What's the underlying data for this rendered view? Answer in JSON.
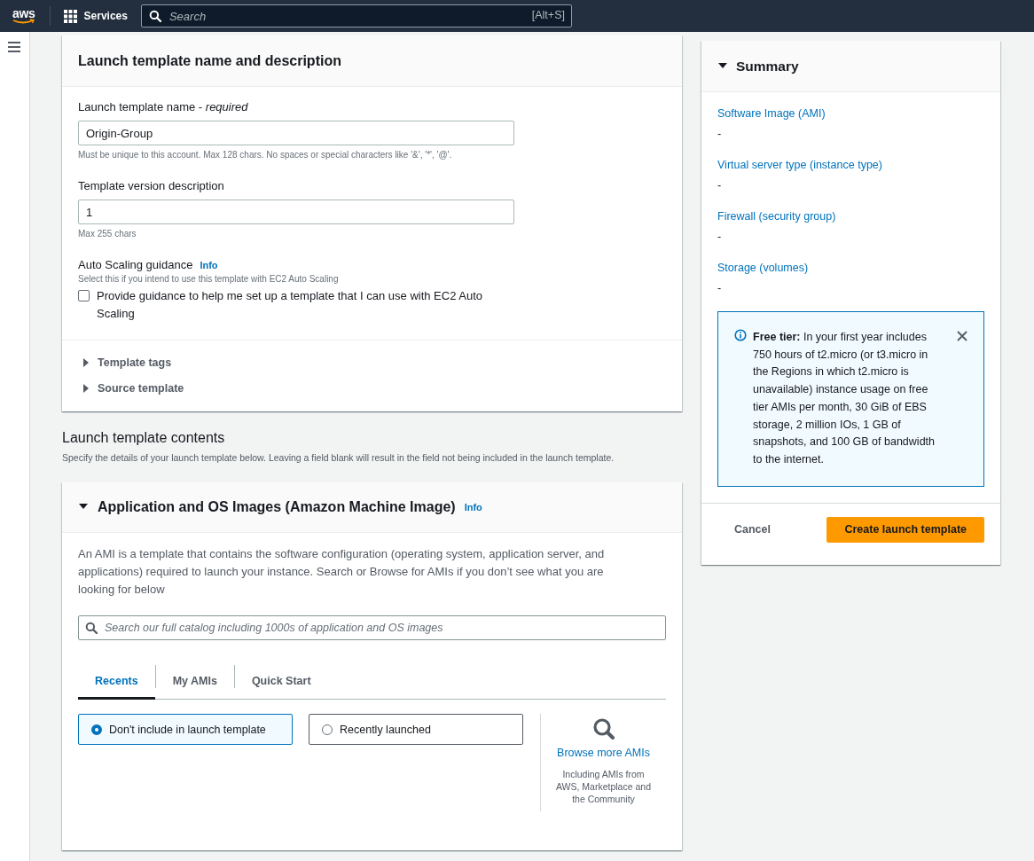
{
  "top_nav": {
    "logo_text": "aws",
    "services": "Services",
    "search": {
      "placeholder": "Search",
      "shortcut": "[Alt+S]"
    }
  },
  "details": {
    "title": "Launch template name and description",
    "fields": [
      {
        "label": "Launch template name - *required*",
        "value": "Origin-Group",
        "hint": "Must be unique to this account. Max 128 chars. No spaces or special characters like '&', '*', '@'."
      },
      {
        "label": "Template version description",
        "value": "1",
        "hint": "Max 255 chars"
      }
    ],
    "auto_scaling": {
      "label": "Auto Scaling guidance",
      "info": "Info",
      "hint": "Select this if you intend to use this template with EC2 Auto Scaling",
      "checkbox": {
        "label": "Provide guidance to help me set up a template that I can use with EC2 Auto Scaling",
        "checked": false
      }
    },
    "sections": [
      {
        "label": "Template tags",
        "expanded": false
      },
      {
        "label": "Source template",
        "expanded": false
      }
    ]
  },
  "contents": {
    "title": "Launch template contents",
    "description": "Specify the details of your launch template below. Leaving a field blank will result in the field not being included in the launch template."
  },
  "ami": {
    "title": "Application and OS Images (Amazon Machine Image)",
    "expanded": true,
    "info": "Info",
    "description": "An AMI is a template that contains the software configuration (operating system, application server, and applications) required to launch your instance. Search or Browse for AMIs if you don’t see what you are looking for below",
    "search": {
      "placeholder": "Search our full catalog including 1000s of application and OS images"
    },
    "tabs": [
      {
        "label": "Recents",
        "selected": true
      },
      {
        "label": "My AMIs",
        "selected": false
      },
      {
        "label": "Quick Start",
        "selected": false
      }
    ],
    "options": [
      {
        "label": "Don't include in launch template",
        "selected": true
      },
      {
        "label": "Recently launched",
        "selected": false
      }
    ],
    "browse": {
      "link": "Browse more AMIs",
      "note": "Including AMIs from AWS, Marketplace and the Community"
    }
  },
  "summary": {
    "title": "Summary",
    "expanded": true,
    "items": [
      {
        "label": "Software Image (AMI)",
        "value": "-"
      },
      {
        "label": "Virtual server type (instance type)",
        "value": "-"
      },
      {
        "label": "Firewall (security group)",
        "value": "-"
      },
      {
        "label": "Storage (volumes)",
        "value": "-"
      }
    ],
    "alert": {
      "text": "**Free tier:** In your first year includes 750 hours of t2.micro (or t3.micro in the Regions in which t2.micro is unavailable) instance usage on free tier AMIs per month, 30 GiB of EBS storage, 2 million IOs, 1 GB of snapshots, and 100 GB of bandwidth to the internet."
    },
    "cancel": "Cancel",
    "create": "Create launch template"
  }
}
